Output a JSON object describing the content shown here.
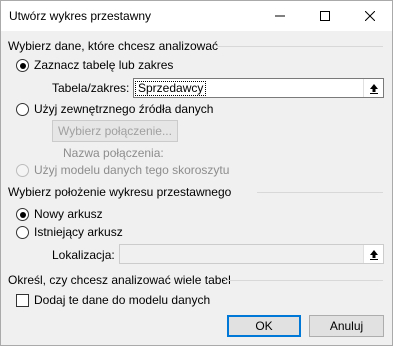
{
  "window": {
    "title": "Utwórz wykres przestawny"
  },
  "data_section": {
    "header": "Wybierz dane, które chcesz analizować",
    "option_table_label": "Zaznacz tabelę lub zakres",
    "table_range_label": "Tabela/zakres:",
    "table_range_value": "Sprzedawcy",
    "option_external_label": "Użyj zewnętrznego źródła danych",
    "choose_connection_label": "Wybierz połączenie...",
    "connection_name_label": "Nazwa połączenia:",
    "option_data_model_label": "Użyj modelu danych tego skoroszytu"
  },
  "location_section": {
    "header": "Wybierz położenie wykresu przestawnego",
    "option_new_sheet_label": "Nowy arkusz",
    "option_existing_sheet_label": "Istniejący arkusz",
    "location_label": "Lokalizacja:",
    "location_value": ""
  },
  "analysis_section": {
    "header": "Określ, czy chcesz analizować wiele tabel",
    "add_to_model_label": "Dodaj te dane do modelu danych"
  },
  "buttons": {
    "ok_label": "OK",
    "cancel_label": "Anuluj"
  },
  "state": {
    "data_source": "table",
    "location": "new_sheet",
    "add_to_model": false
  }
}
